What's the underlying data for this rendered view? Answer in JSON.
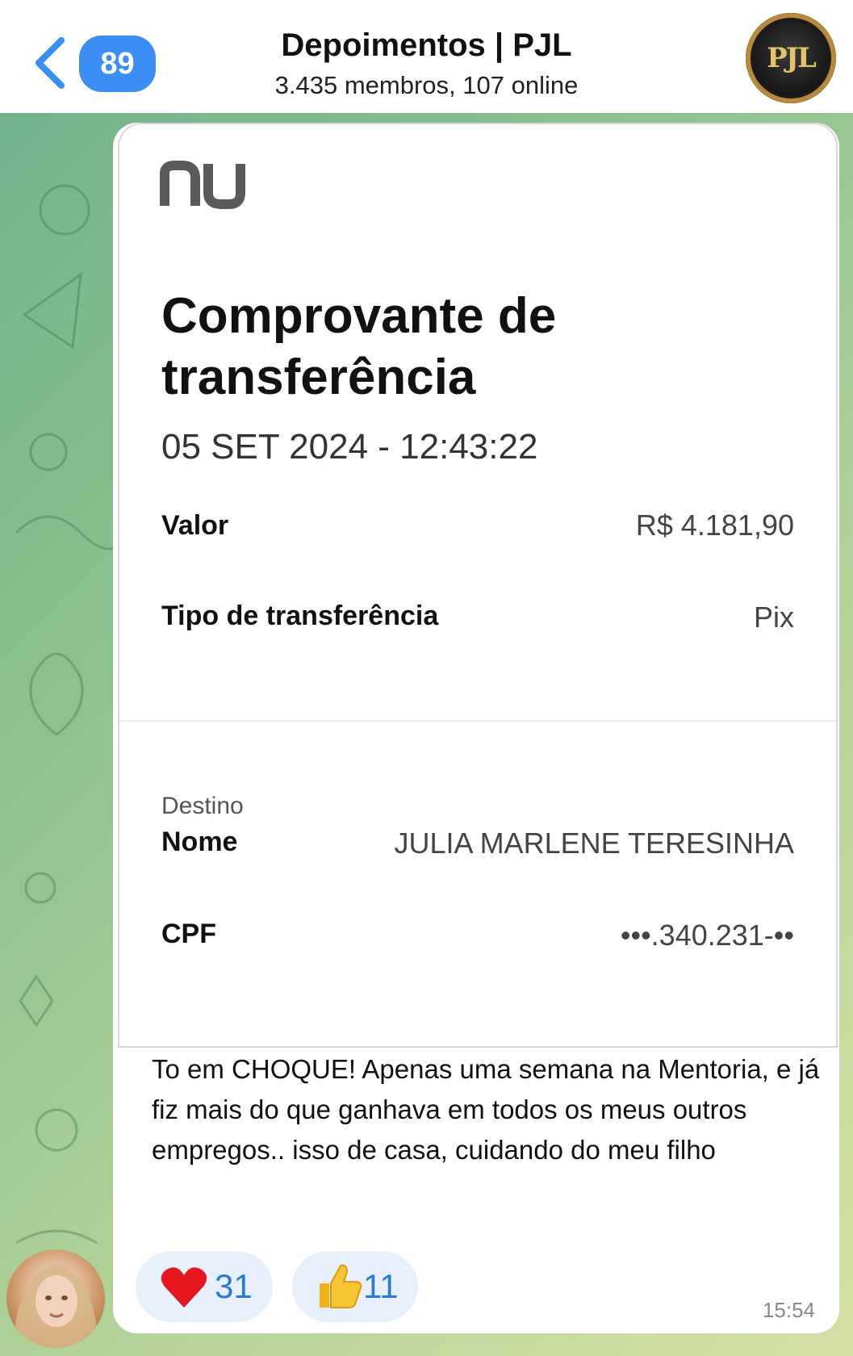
{
  "header": {
    "back_icon": "chevron-left-icon",
    "unread_count": "89",
    "title": "Depoimentos | PJL",
    "subtitle": "3.435 membros, 107 online",
    "avatar_text": "PJL"
  },
  "receipt": {
    "logo": "nu",
    "title": "Comprovante de transferência",
    "datetime": "05 SET 2024 - 12:43:22",
    "rows": [
      {
        "label": "Valor",
        "value": "R$ 4.181,90"
      },
      {
        "label": "Tipo de transferência",
        "value": "Pix"
      }
    ],
    "section": "Destino",
    "dest_rows": [
      {
        "label": "Nome",
        "value": "JULIA MARLENE TERESINHA"
      },
      {
        "label": "CPF",
        "value": "•••.340.231-••"
      }
    ]
  },
  "message": {
    "text": "To em CHOQUE! Apenas uma semana na Mentoria, e já fiz mais do que ganhava em todos os meus outros empregos.. isso de casa, cuidando do meu filho",
    "time": "15:54",
    "reactions": [
      {
        "icon": "heart-icon",
        "count": "31"
      },
      {
        "icon": "thumbs-up-icon",
        "count": "11"
      }
    ]
  },
  "colors": {
    "accent": "#3a8ef6",
    "reaction_bg": "#e8f1fb",
    "reaction_text": "#2a7ad6"
  }
}
